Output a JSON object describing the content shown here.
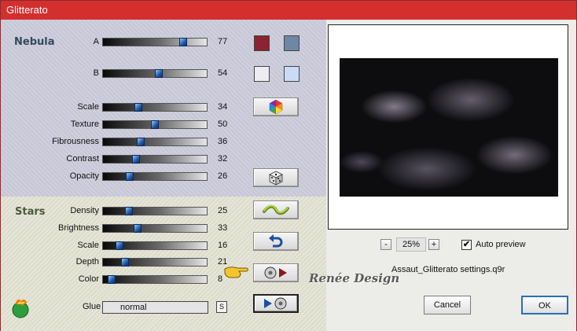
{
  "window": {
    "title": "Glitterato"
  },
  "nebula": {
    "title": "Nebula",
    "params": [
      {
        "label": "A",
        "value": "77",
        "level": 77
      },
      {
        "label": "B",
        "value": "54",
        "level": 54
      },
      {
        "label": "Scale",
        "value": "34",
        "level": 34
      },
      {
        "label": "Texture",
        "value": "50",
        "level": 50
      },
      {
        "label": "Fibrousness",
        "value": "36",
        "level": 36
      },
      {
        "label": "Contrast",
        "value": "32",
        "level": 32
      },
      {
        "label": "Opacity",
        "value": "26",
        "level": 26
      }
    ],
    "swatches": [
      "#8b2330",
      "#6f87a4",
      "#ececf2",
      "#c8dcf6"
    ]
  },
  "stars": {
    "title": "Stars",
    "params": [
      {
        "label": "Density",
        "value": "25",
        "level": 25
      },
      {
        "label": "Brightness",
        "value": "33",
        "level": 33
      },
      {
        "label": "Scale",
        "value": "16",
        "level": 16
      },
      {
        "label": "Depth",
        "value": "21",
        "level": 21
      },
      {
        "label": "Color",
        "value": "8",
        "level": 8
      }
    ]
  },
  "glue": {
    "label": "Glue",
    "value": "normal",
    "button": "S"
  },
  "preview": {
    "zoom": "25%",
    "zoom_out": "-",
    "zoom_in": "+",
    "auto_preview_label": "Auto preview",
    "auto_preview_checked": "✔",
    "settings_file": "Assaut_Glitterato settings.q9r"
  },
  "buttons": {
    "cancel": "Cancel",
    "ok": "OK"
  },
  "watermark": "Renée Design",
  "icons": [
    "color-wheel-icon",
    "dice-icon",
    "wave-icon",
    "undo-icon",
    "load-preset-icon",
    "save-preset-icon",
    "flame-logo-icon",
    "pointing-hand-icon"
  ]
}
